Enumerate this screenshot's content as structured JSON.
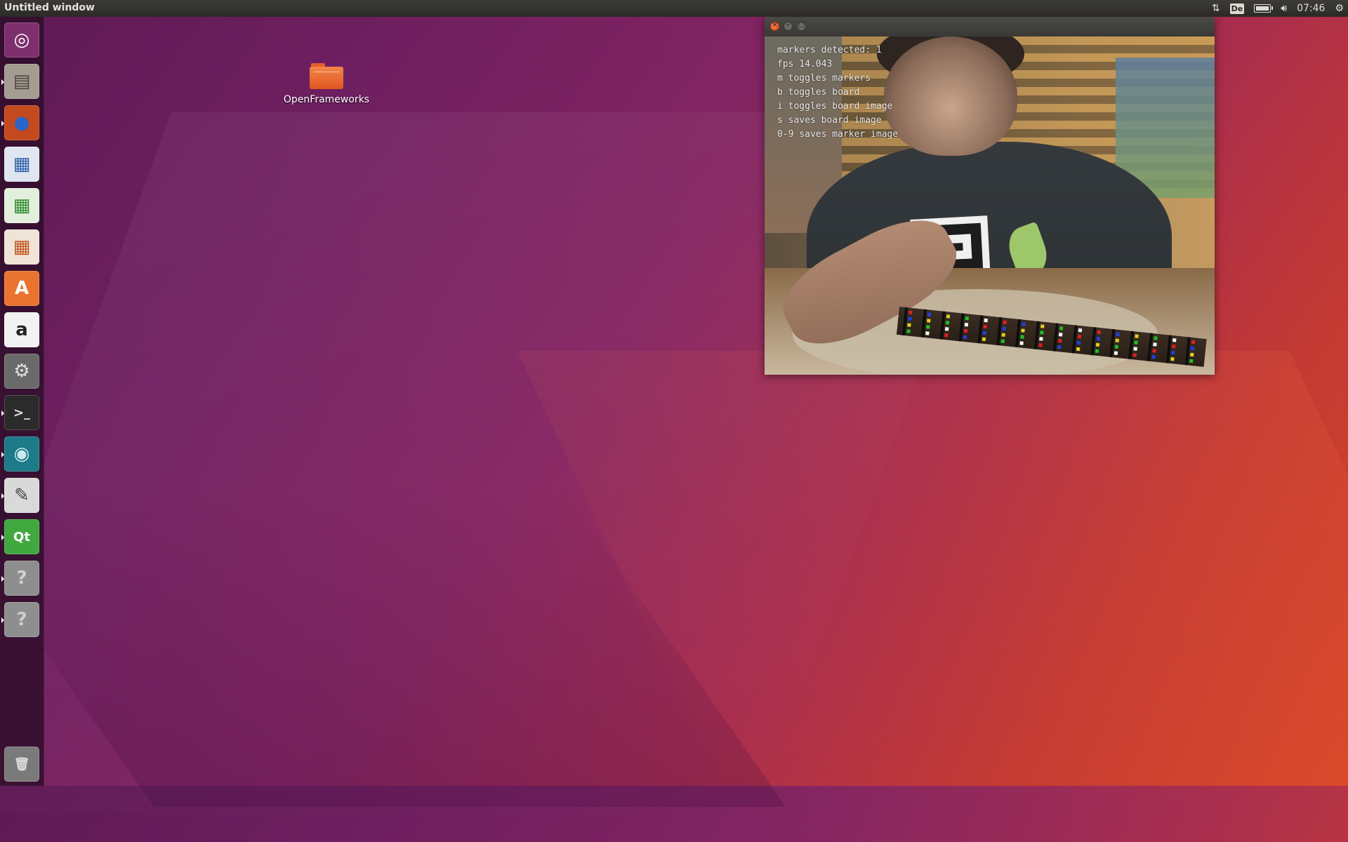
{
  "top_panel": {
    "window_title": "Untitled window",
    "keyboard_layout": "De",
    "clock": "07:46"
  },
  "launcher": {
    "items": [
      {
        "name": "ubuntu-dash",
        "glyph": "◎",
        "bg": "#7d2f6e",
        "fg": "#ffffff",
        "running": false
      },
      {
        "name": "files",
        "glyph": "▤",
        "bg": "#a49c91",
        "fg": "#4a4540",
        "running": true
      },
      {
        "name": "firefox",
        "glyph": "●",
        "bg": "#c34a1e",
        "fg": "#2a65c8",
        "running": true
      },
      {
        "name": "libreoffice-writer",
        "glyph": "▦",
        "bg": "#dfe6f0",
        "fg": "#2a5fa8",
        "running": false
      },
      {
        "name": "libreoffice-calc",
        "glyph": "▦",
        "bg": "#e2efdc",
        "fg": "#2e8a2e",
        "running": false
      },
      {
        "name": "libreoffice-impress",
        "glyph": "▦",
        "bg": "#f0e3d8",
        "fg": "#c2521d",
        "running": false
      },
      {
        "name": "ubuntu-software",
        "glyph": "A",
        "bg": "#e8742f",
        "fg": "#ffffff",
        "running": false
      },
      {
        "name": "amazon",
        "glyph": "a",
        "bg": "#f2f2f2",
        "fg": "#222222",
        "running": false
      },
      {
        "name": "system-settings",
        "glyph": "⚙",
        "bg": "#6a6a6a",
        "fg": "#e0e0e0",
        "running": false
      },
      {
        "name": "terminal",
        "glyph": ">_",
        "bg": "#2b2b2b",
        "fg": "#e0e0e0",
        "running": true
      },
      {
        "name": "gitkraken",
        "glyph": "◉",
        "bg": "#1d7a88",
        "fg": "#cfe9ef",
        "running": true
      },
      {
        "name": "text-editor",
        "glyph": "✎",
        "bg": "#d9d9d9",
        "fg": "#444444",
        "running": true
      },
      {
        "name": "qt-creator",
        "glyph": "Qt",
        "bg": "#41a83f",
        "fg": "#ffffff",
        "running": true
      },
      {
        "name": "unknown-app-1",
        "glyph": "?",
        "bg": "#8e8e8e",
        "fg": "#cfcfcf",
        "running": true
      },
      {
        "name": "unknown-app-2",
        "glyph": "?",
        "bg": "#8e8e8e",
        "fg": "#cfcfcf",
        "running": true
      },
      {
        "name": "trash",
        "glyph": "🗑",
        "bg": "#7a7a7a",
        "fg": "#dcdcdc",
        "running": false
      }
    ]
  },
  "desktop": {
    "folder_label": "OpenFrameworks"
  },
  "app_window": {
    "overlay_lines": [
      "markers detected: 1",
      "fps 14.043",
      "m toggles markers",
      "b toggles board",
      "i toggles board image",
      "s saves board image",
      "0-9 saves marker image"
    ]
  },
  "colors": {
    "accent_close": "#df4a16",
    "folder": "#e1551f"
  }
}
